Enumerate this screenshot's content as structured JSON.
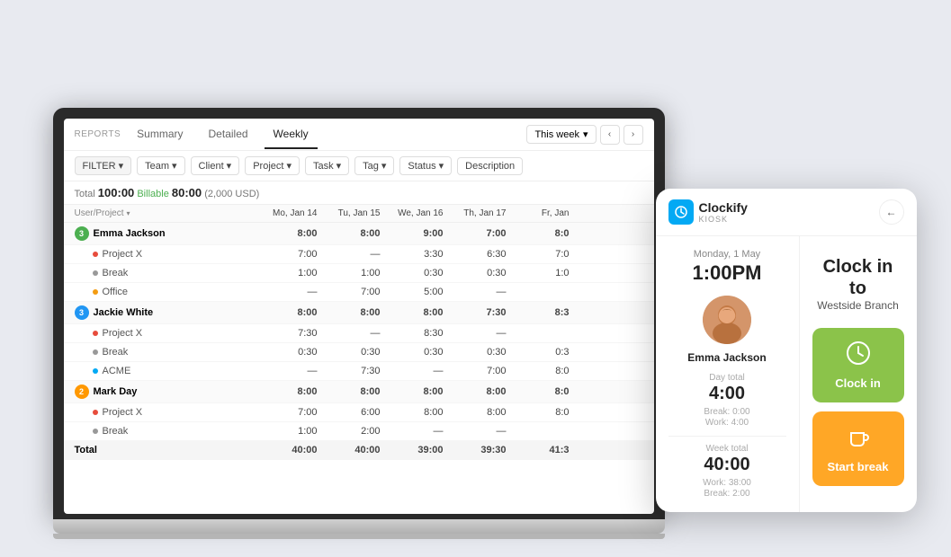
{
  "header": {
    "reports_label": "REPORTS",
    "tabs": [
      {
        "label": "Summary",
        "active": false
      },
      {
        "label": "Detailed",
        "active": false
      },
      {
        "label": "Weekly",
        "active": true
      }
    ],
    "week_selector": "This week",
    "nav_prev": "‹",
    "nav_next": "›"
  },
  "toolbar": {
    "filter": "FILTER",
    "filters": [
      "Team",
      "Client",
      "Project",
      "Task",
      "Tag",
      "Status",
      "Description"
    ]
  },
  "summary": {
    "total_label": "Total",
    "total_value": "100:00",
    "billable_label": "Billable",
    "billable_value": "80:00",
    "billable_amount": "(2,000 USD)"
  },
  "table": {
    "group_by": "User/Project",
    "columns": [
      "Mo, Jan 14",
      "Tu, Jan 15",
      "We, Jan 16",
      "Th, Jan 17",
      "Fr, Jan"
    ],
    "rows": [
      {
        "type": "user",
        "badge_color": "#4CAF50",
        "badge_num": "3",
        "name": "Emma Jackson",
        "cells": [
          "8:00",
          "8:00",
          "9:00",
          "7:00",
          "8:0"
        ]
      },
      {
        "type": "project",
        "dot_color": "#e74c3c",
        "name": "Project X",
        "cells": [
          "7:00",
          "—",
          "3:30",
          "6:30",
          "7:0"
        ]
      },
      {
        "type": "project",
        "dot_color": "#666",
        "name": "Break",
        "cells": [
          "1:00",
          "1:00",
          "0:30",
          "0:30",
          "1:0"
        ]
      },
      {
        "type": "project",
        "dot_color": "#f39c12",
        "name": "Office",
        "cells": [
          "—",
          "7:00",
          "5:00",
          "—",
          ""
        ]
      },
      {
        "type": "user",
        "badge_color": "#2196F3",
        "badge_num": "3",
        "name": "Jackie White",
        "cells": [
          "8:00",
          "8:00",
          "8:00",
          "7:30",
          "8:3"
        ]
      },
      {
        "type": "project",
        "dot_color": "#e74c3c",
        "name": "Project X",
        "cells": [
          "7:30",
          "—",
          "8:30",
          "—",
          ""
        ]
      },
      {
        "type": "project",
        "dot_color": "#666",
        "name": "Break",
        "cells": [
          "0:30",
          "0:30",
          "0:30",
          "0:30",
          "0:3"
        ]
      },
      {
        "type": "project",
        "dot_color": "#03A9F4",
        "name": "ACME",
        "cells": [
          "—",
          "7:30",
          "—",
          "7:00",
          "8:0"
        ]
      },
      {
        "type": "user",
        "badge_color": "#FF9800",
        "badge_num": "2",
        "name": "Mark Day",
        "cells": [
          "8:00",
          "8:00",
          "8:00",
          "8:00",
          "8:0"
        ]
      },
      {
        "type": "project",
        "dot_color": "#e74c3c",
        "name": "Project X",
        "cells": [
          "7:00",
          "6:00",
          "8:00",
          "8:00",
          "8:0"
        ]
      },
      {
        "type": "project",
        "dot_color": "#666",
        "name": "Break",
        "cells": [
          "1:00",
          "2:00",
          "—",
          "—",
          ""
        ]
      },
      {
        "type": "total",
        "name": "Total",
        "cells": [
          "40:00",
          "40:00",
          "39:00",
          "39:30",
          "41:3"
        ]
      }
    ]
  },
  "kiosk": {
    "logo_letter": "c",
    "app_name": "Clockify",
    "app_sub": "KIOSK",
    "back_arrow": "←",
    "date": "Monday, 1 May",
    "time": "1:00PM",
    "user_name": "Emma Jackson",
    "day_total_label": "Day total",
    "day_total_value": "4:00",
    "day_break_label": "Break: 0:00",
    "day_work_label": "Work: 4:00",
    "week_total_label": "Week total",
    "week_total_value": "40:00",
    "week_work_label": "Work: 38:00",
    "week_break_label": "Break: 2:00",
    "clock_in_title": "Clock in to",
    "clock_in_branch": "Westside Branch",
    "btn_clock_in": "Clock in",
    "btn_start_break": "Start break",
    "clock_icon": "🕐",
    "cup_icon": "☕"
  }
}
